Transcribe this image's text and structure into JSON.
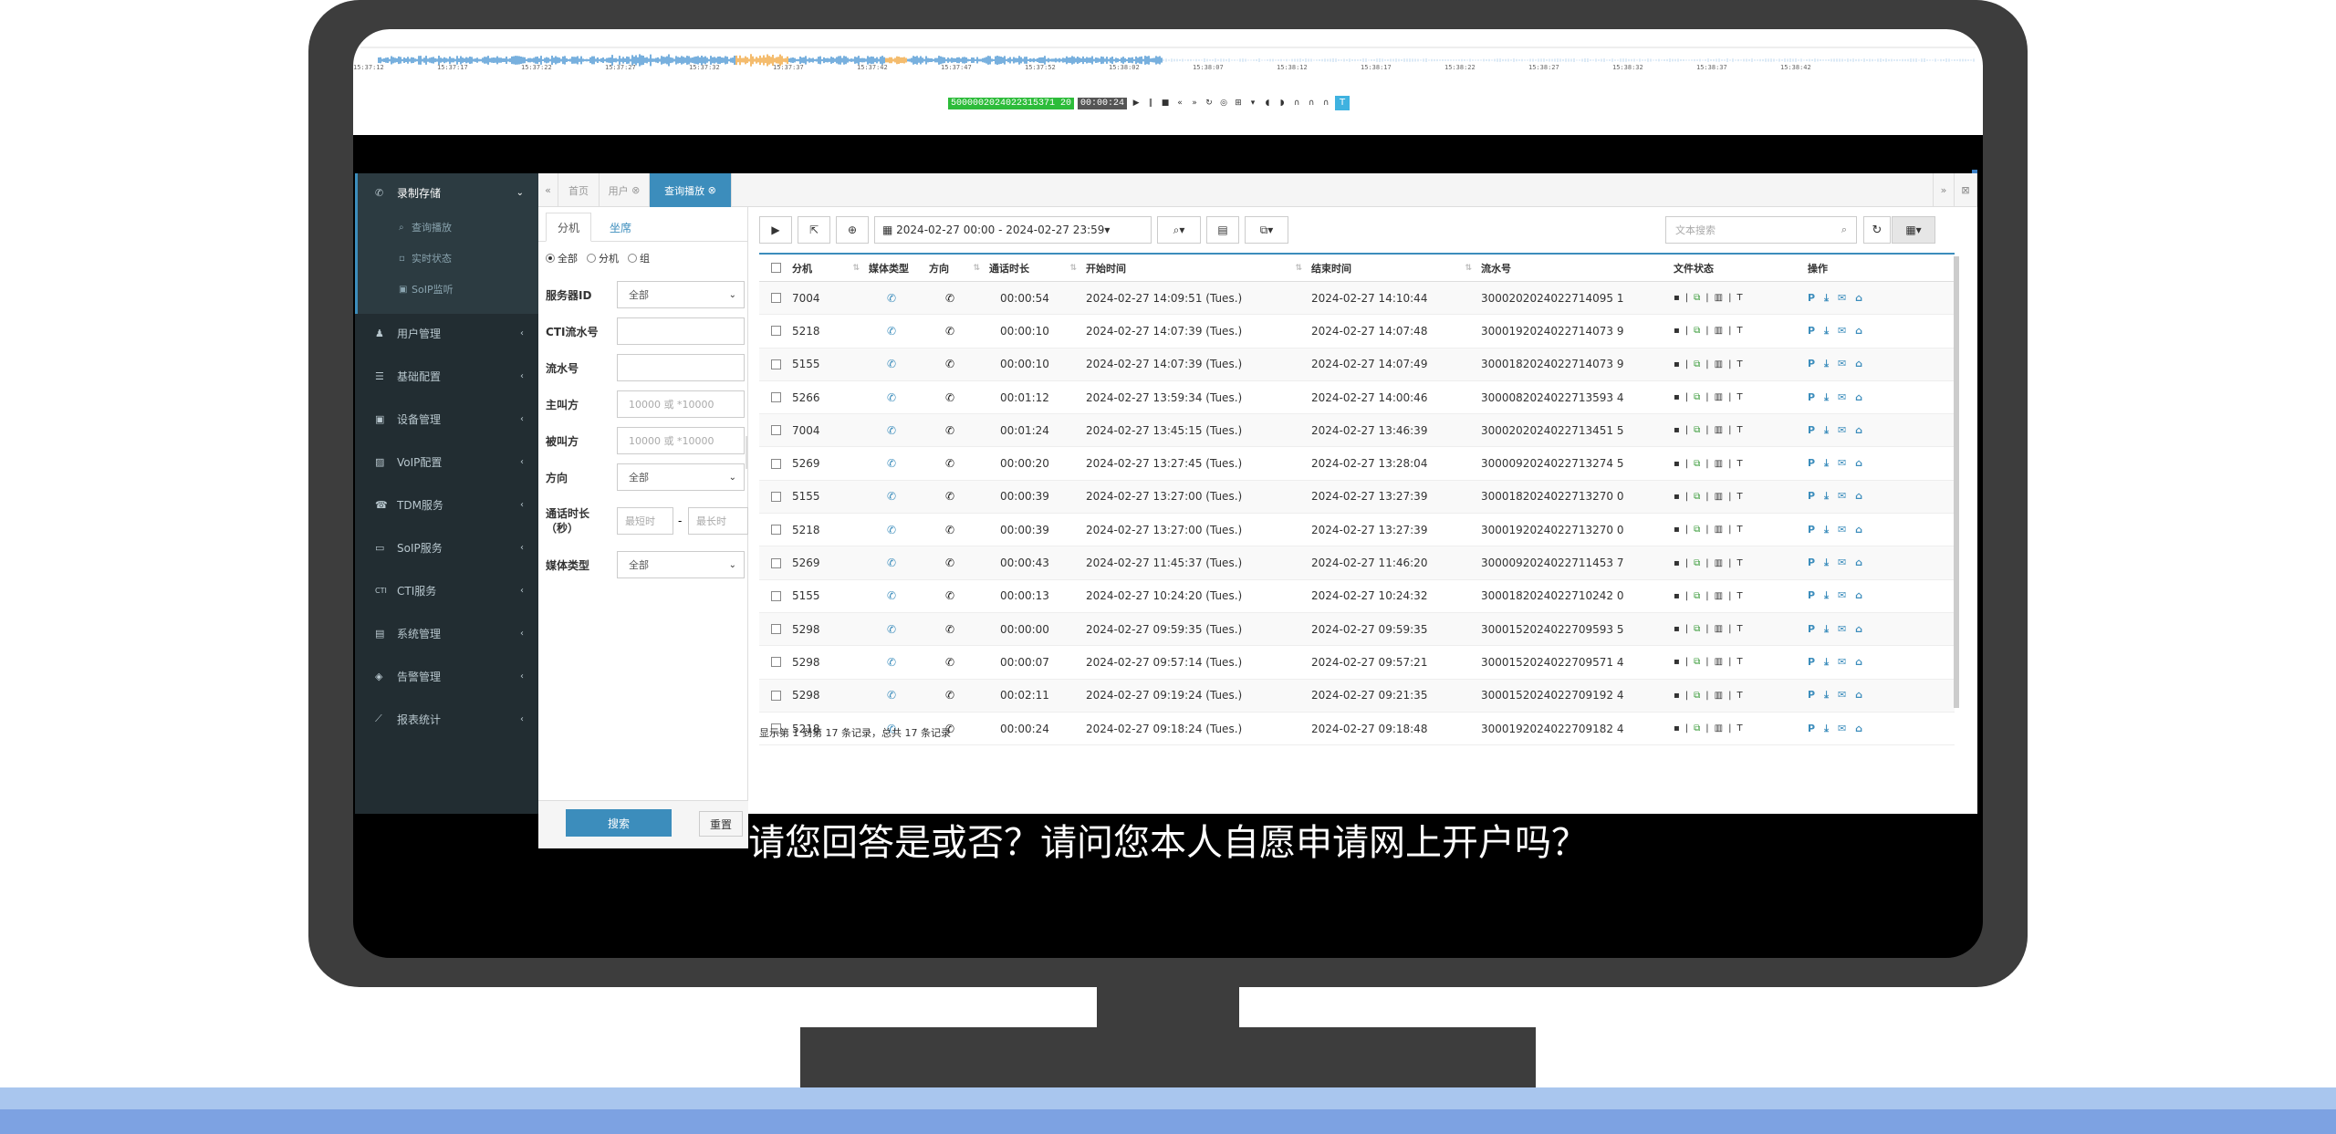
{
  "player": {
    "record_id": "5000002024022315371 20",
    "time": "00:00:24",
    "t_button": "T",
    "top_ticks": [
      "15:37:12",
      "15:37:17",
      "15:37:22",
      "15:37:27",
      "15:37:32",
      "15:37:37",
      "15:37:42",
      "15:37:47",
      "15:37:52",
      "15:38:02",
      "15:38:07",
      "15:38:12",
      "15:38:17",
      "15:38:22",
      "15:38:27",
      "15:38:32",
      "15:38:37",
      "15:38:42"
    ]
  },
  "sidebar": {
    "items": [
      {
        "label": "录制存储",
        "icon": "phone-icon",
        "expanded": true
      },
      {
        "label": "用户管理",
        "icon": "user-icon"
      },
      {
        "label": "基础配置",
        "icon": "sliders-icon"
      },
      {
        "label": "设备管理",
        "icon": "device-icon"
      },
      {
        "label": "VoIP配置",
        "icon": "image-icon"
      },
      {
        "label": "TDM服务",
        "icon": "phone-icon"
      },
      {
        "label": "SoIP服务",
        "icon": "monitor-icon"
      },
      {
        "label": "CTI服务",
        "icon": "cti-icon"
      },
      {
        "label": "系统管理",
        "icon": "drive-icon"
      },
      {
        "label": "告警管理",
        "icon": "alarm-icon"
      },
      {
        "label": "报表统计",
        "icon": "chart-icon"
      }
    ],
    "sub_items": [
      {
        "label": "查询播放",
        "icon": "search-icon"
      },
      {
        "label": "实时状态",
        "icon": "status-icon"
      },
      {
        "label": "SoIP监听",
        "icon": "listen-icon"
      }
    ]
  },
  "tabs": [
    {
      "label": "首页"
    },
    {
      "label": "用户"
    },
    {
      "label": "查询播放",
      "active": true
    }
  ],
  "filter": {
    "tab_ext": "分机",
    "tab_seat": "坐席",
    "radios": [
      "全部",
      "分机",
      "组"
    ],
    "server_label": "服务器ID",
    "server_value": "全部",
    "cti_label": "CTI流水号",
    "serial_label": "流水号",
    "caller_label": "主叫方",
    "caller_placeholder": "10000 或 *10000",
    "callee_label": "被叫方",
    "callee_placeholder": "10000 或 *10000",
    "direction_label": "方向",
    "direction_value": "全部",
    "duration_label": "通话时长（秒）",
    "min_placeholder": "最短时",
    "dash": "-",
    "max_placeholder": "最长时",
    "media_label": "媒体类型",
    "media_value": "全部",
    "search_button": "搜索",
    "reset_button": "重置"
  },
  "toolbar": {
    "date_range": "2024-02-27 00:00 - 2024-02-27 23:59",
    "text_search_placeholder": "文本搜索"
  },
  "table": {
    "headers": [
      "分机",
      "媒体类型",
      "方向",
      "通话时长",
      "开始时间",
      "结束时间",
      "流水号",
      "文件状态",
      "操作"
    ],
    "rows": [
      {
        "ext": "7004",
        "dur": "00:00:54",
        "start": "2024-02-27 14:09:51 (Tues.)",
        "end": "2024-02-27 14:10:44",
        "serial": "3000202024022714095 1"
      },
      {
        "ext": "5218",
        "dur": "00:00:10",
        "start": "2024-02-27 14:07:39 (Tues.)",
        "end": "2024-02-27 14:07:48",
        "serial": "3000192024022714073 9"
      },
      {
        "ext": "5155",
        "dur": "00:00:10",
        "start": "2024-02-27 14:07:39 (Tues.)",
        "end": "2024-02-27 14:07:49",
        "serial": "3000182024022714073 9"
      },
      {
        "ext": "5266",
        "dur": "00:01:12",
        "start": "2024-02-27 13:59:34 (Tues.)",
        "end": "2024-02-27 14:00:46",
        "serial": "3000082024022713593 4"
      },
      {
        "ext": "7004",
        "dur": "00:01:24",
        "start": "2024-02-27 13:45:15 (Tues.)",
        "end": "2024-02-27 13:46:39",
        "serial": "3000202024022713451 5"
      },
      {
        "ext": "5269",
        "dur": "00:00:20",
        "start": "2024-02-27 13:27:45 (Tues.)",
        "end": "2024-02-27 13:28:04",
        "serial": "3000092024022713274 5"
      },
      {
        "ext": "5155",
        "dur": "00:00:39",
        "start": "2024-02-27 13:27:00 (Tues.)",
        "end": "2024-02-27 13:27:39",
        "serial": "3000182024022713270 0"
      },
      {
        "ext": "5218",
        "dur": "00:00:39",
        "start": "2024-02-27 13:27:00 (Tues.)",
        "end": "2024-02-27 13:27:39",
        "serial": "3000192024022713270 0"
      },
      {
        "ext": "5269",
        "dur": "00:00:43",
        "start": "2024-02-27 11:45:37 (Tues.)",
        "end": "2024-02-27 11:46:20",
        "serial": "3000092024022711453 7"
      },
      {
        "ext": "5155",
        "dur": "00:00:13",
        "start": "2024-02-27 10:24:20 (Tues.)",
        "end": "2024-02-27 10:24:32",
        "serial": "3000182024022710242 0"
      },
      {
        "ext": "5298",
        "dur": "00:00:00",
        "start": "2024-02-27 09:59:35 (Tues.)",
        "end": "2024-02-27 09:59:35",
        "serial": "3000152024022709593 5"
      },
      {
        "ext": "5298",
        "dur": "00:00:07",
        "start": "2024-02-27 09:57:14 (Tues.)",
        "end": "2024-02-27 09:57:21",
        "serial": "3000152024022709571 4"
      },
      {
        "ext": "5298",
        "dur": "00:02:11",
        "start": "2024-02-27 09:19:24 (Tues.)",
        "end": "2024-02-27 09:21:35",
        "serial": "3000152024022709192 4"
      },
      {
        "ext": "5218",
        "dur": "00:00:24",
        "start": "2024-02-27 09:18:24 (Tues.)",
        "end": "2024-02-27 09:18:48",
        "serial": "3000192024022709182 4"
      }
    ],
    "pager_text": "显示第 1 到第 17 条记录，总共 17 条记录"
  },
  "subtitle": "请您回答是或否？请问您本人自愿申请网上开户吗？",
  "colors": {
    "accent": "#3c8dbc",
    "sidebar": "#222d32",
    "monitor": "#3d3d3d",
    "floor_light": "#a9c6ee",
    "floor_dark": "#7da2e2"
  }
}
